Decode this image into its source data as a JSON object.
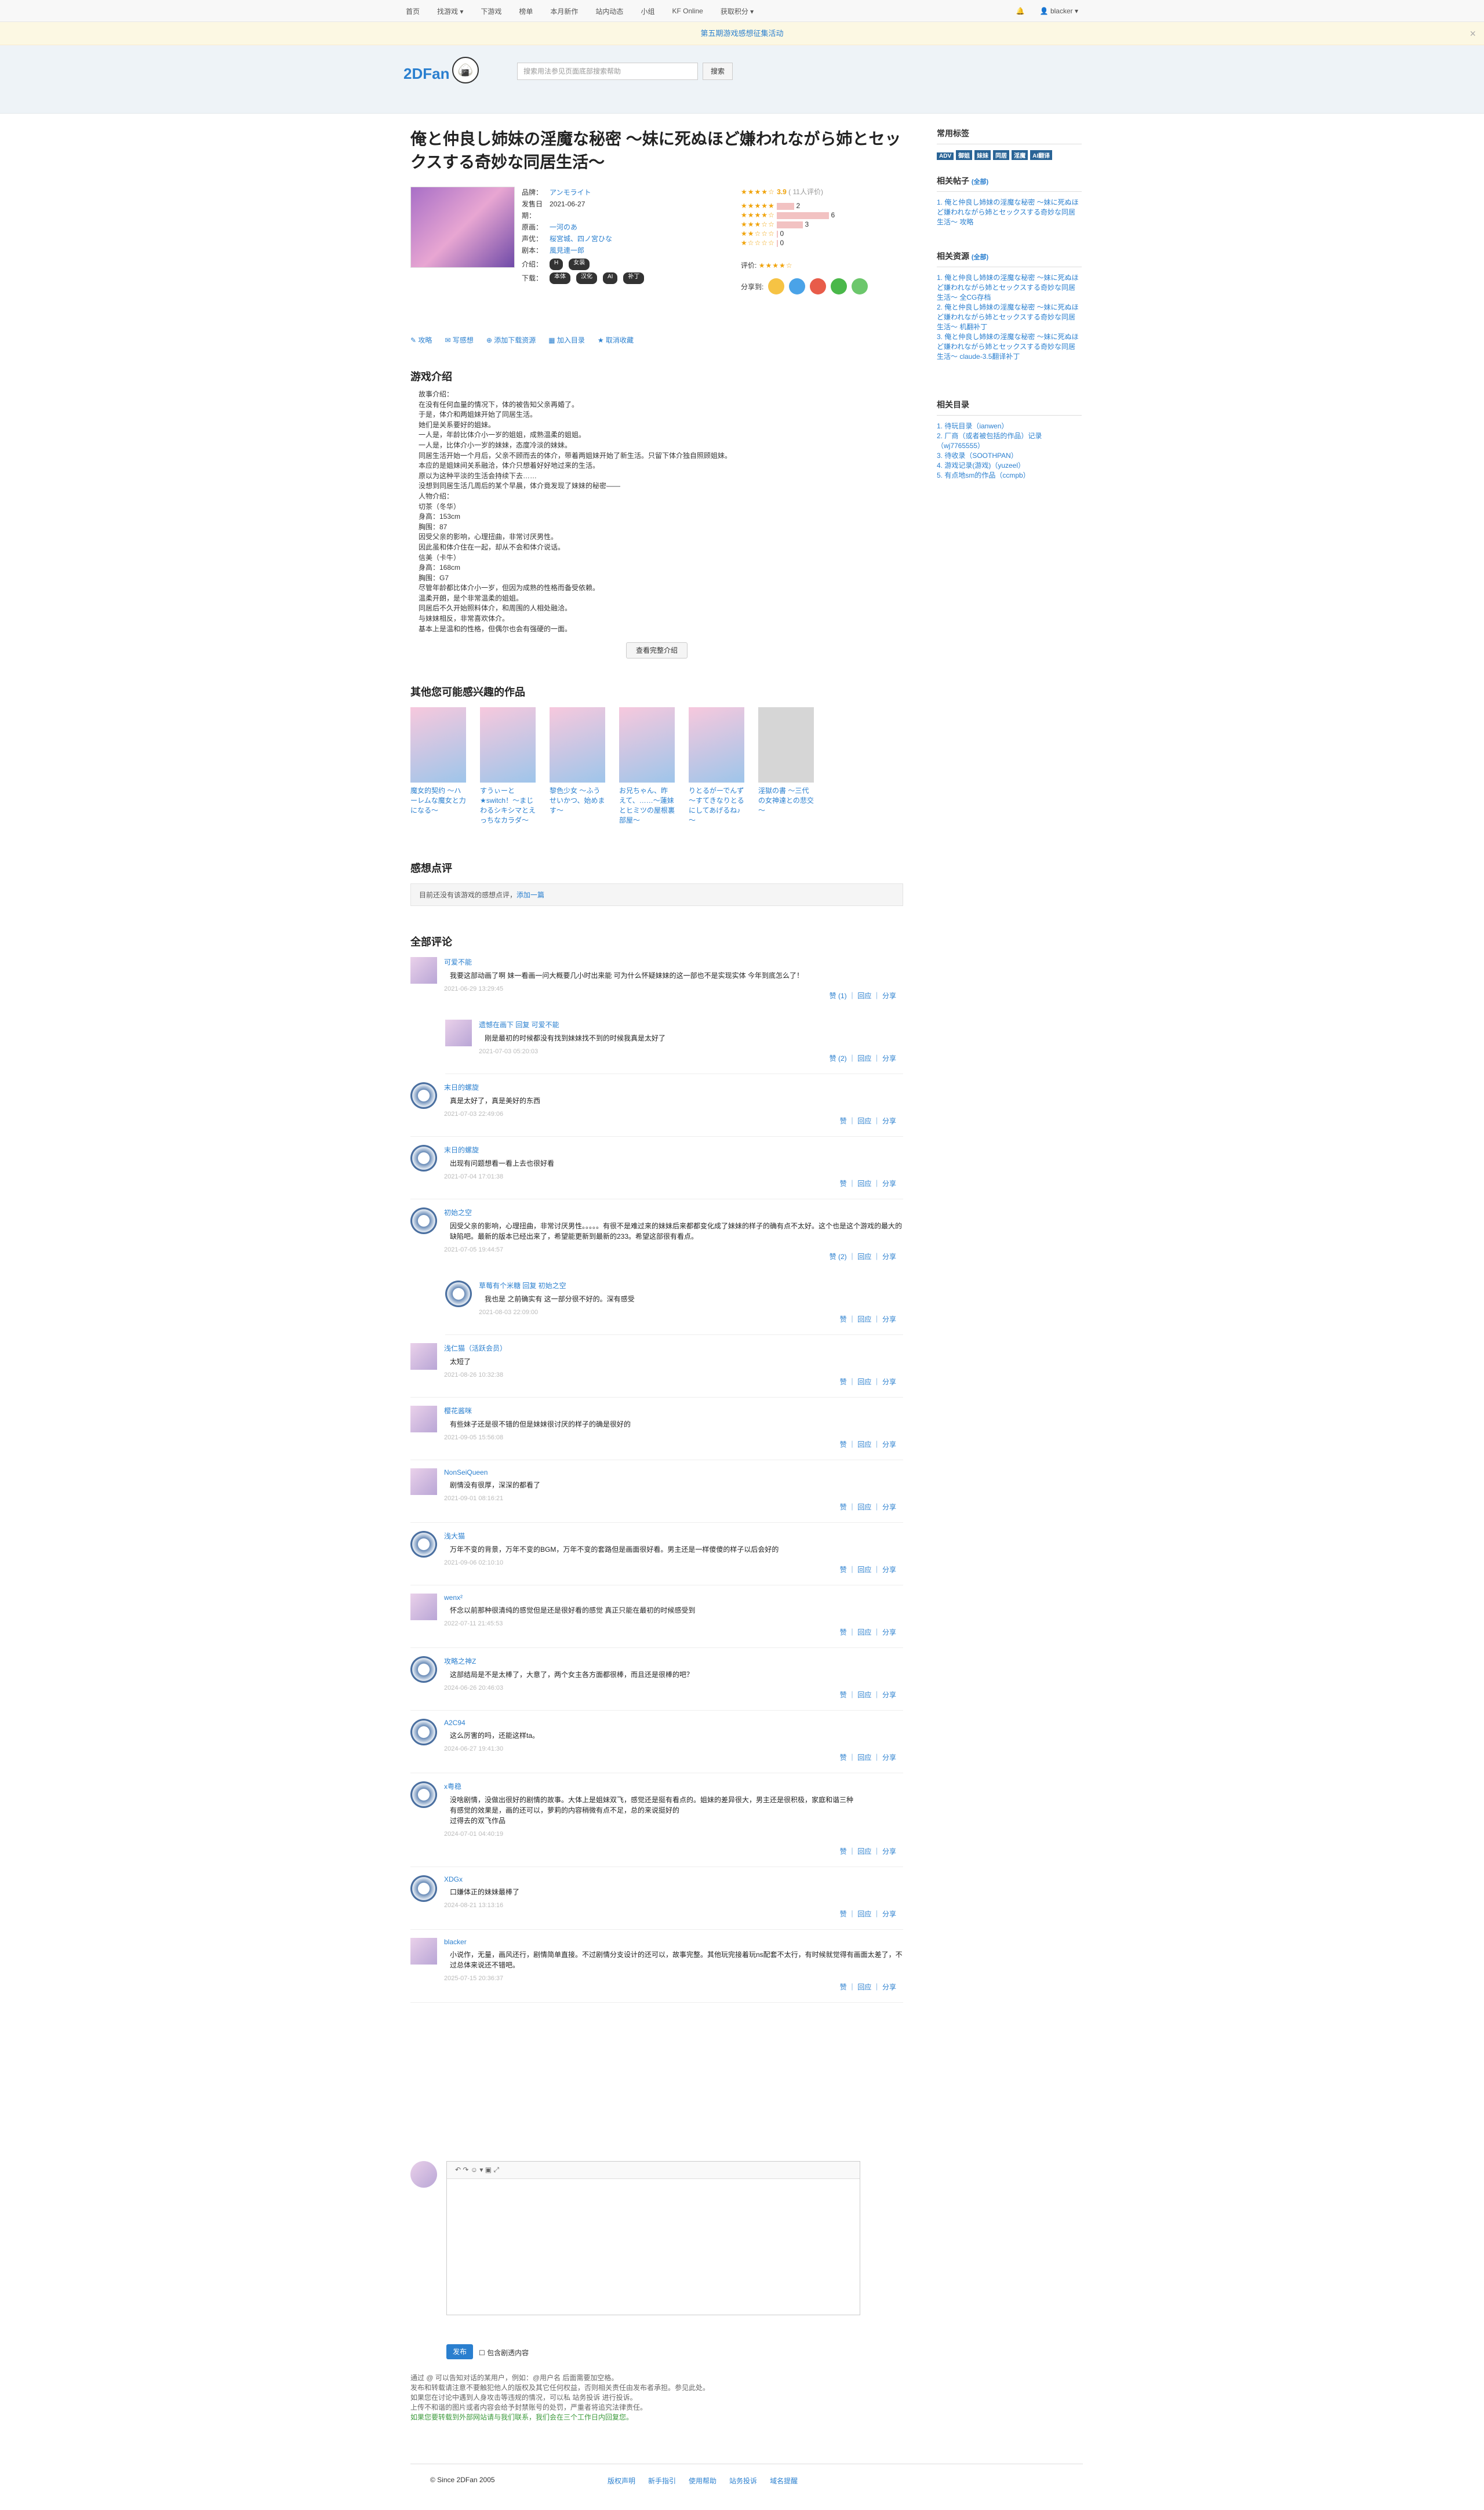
{
  "nav": {
    "items": [
      "首页",
      "找游戏 ▾",
      "下游戏",
      "榜单",
      "本月新作",
      "站内动态",
      "小组",
      "KF Online",
      "获取积分 ▾"
    ],
    "user": "blacker ▾"
  },
  "banner": {
    "text": "第五期游戏感想征集活动",
    "close": "×"
  },
  "header": {
    "logo": "2DFan",
    "search_placeholder": "搜索用法参见页面底部搜索帮助",
    "search_button": "搜索"
  },
  "game": {
    "title": "俺と仲良し姉妹の淫魔な秘密 ～妹に死ぬほど嫌われながら姉とセックスする奇妙な同居生活～",
    "brand": "アンモライト",
    "release": "2021-06-27",
    "original": "一河のあ",
    "cv": "桜宮城、四ノ宮ひな",
    "script": "風見連一郎",
    "intro_tags": [
      "H",
      "女装"
    ],
    "download_tags": [
      "本体",
      "汉化",
      "AI",
      "补丁"
    ]
  },
  "rating": {
    "score": "3.9",
    "count": "( 11人评价)",
    "dist": [
      "2",
      "6",
      "3",
      "0",
      "0"
    ],
    "my_label": "评价:",
    "share_label": "分享到:"
  },
  "actions": [
    "攻略",
    "写感想",
    "添加下载资源",
    "加入目录",
    "取消收藏"
  ],
  "intro": {
    "heading": "游戏介绍",
    "text": "故事介绍：\n在没有任何血量的情况下，体的被告知父亲再婚了。\n于是，体介和两姐妹开始了同居生活。\n她们是关系要好的姐妹。\n一人是，年龄比体介小一岁的姐姐，成熟温柔的姐姐。\n一人是，比体介小一岁的妹妹，态度冷淡的妹妹。\n同居生活开始一个月后，父亲不顾而去的体介，带着两姐妹开始了新生活。只留下体介独自照顾姐妹。\n本应的是姐妹间关系融洽，体介只想着好好地过来的生活。\n原以为这种平淡的生活会持续下去……\n没想到同居生活几周后的某个早晨，体介竟发现了妹妹的秘密——\n人物介绍：\n切茶（冬华）\n身高：153cm\n胸围：87\n因受父亲的影响，心理扭曲，非常讨厌男性。\n因此虽和体介住在一起，却从不会和体介说话。\n信美（卡牛）\n身高：168cm\n胸围：G7\n尽管年龄都比体介小一岁，但因为成熟的性格而备受依赖。\n温柔开朗，是个非常温柔的姐姐。\n同居后不久开始照料体介，和周围的人相处融洽。\n与妹妹相反，非常喜欢体介。\n基本上是温和的性格，但偶尔也会有强硬的一面。",
    "more_button": "查看完整介绍"
  },
  "recommend": {
    "heading": "其他您可能感兴趣的作品",
    "items": [
      "魔女的契约 ～ハーレムな魔女と力になる～",
      "すうぃーと★switch！～まじわるシキシマとえっちなカラダ～",
      "黎色少女 ～ふうせいかつ、始めます～",
      "お兄ちゃん、昨えて、……～蓮妹とヒミツの屋根裏部屋～",
      "りとるがーでんず ～すてきなりとるにしてあげるね♪～",
      "淫獄の書 ～三代の女神達との悲交～"
    ]
  },
  "review": {
    "heading": "感想点评",
    "empty": "目前还没有该游戏的感想点评，",
    "link": "添加一篇"
  },
  "comments_heading": "全部评论",
  "comments": [
    {
      "name": "可爱不能",
      "text": "我要这部动画了啊 妹一看画一问大概要几小时出来能 可为什么怀疑妹妹的这一部也不是实现实体 今年到底怎么了！",
      "time": "2021-06-29 13:29:45",
      "act": "赞 (1) ｜ 回应 ｜ 分享"
    },
    {
      "name": "遗憾在画下 回复 可爱不能",
      "text": "刚是最初的时候都没有找到妹妹找不到的时候我真是太好了",
      "time": "2021-07-03 05:20:03",
      "act": "赞 (2) ｜ 回应 ｜ 分享"
    },
    {
      "name": "末日的螺旋",
      "text": "真是太好了，真是美好的东西",
      "time": "2021-07-03 22:49:06",
      "act": "赞 ｜ 回应 ｜ 分享"
    },
    {
      "name": "末日的螺旋",
      "text": "出现有问题想看一看上去也很好看",
      "time": "2021-07-04 17:01:38",
      "act": "赞 ｜ 回应 ｜ 分享"
    },
    {
      "name": "初始之空",
      "text": "因受父亲的影响，心理扭曲，非常讨厌男性。。。。。有很不是难过来的妹妹后来都都变化成了妹妹的样子的确有点不太好。这个也是这个游戏的最大的缺陷吧。最新的版本已经出来了，希望能更新到最新的233。希望这部很有看点。",
      "time": "2021-07-05 19:44:57",
      "act": "赞 (2) ｜ 回应 ｜ 分享"
    },
    {
      "name": "草莓有个米糖 回复 初始之空",
      "text": "我也是 之前确实有 这一部分很不好的。深有感受",
      "time": "2021-08-03 22:09:00",
      "act": "赞 ｜ 回应 ｜ 分享"
    },
    {
      "name": "浅仁猫（活跃会员）",
      "text": "太短了",
      "time": "2021-08-26 10:32:38",
      "act": "赞 ｜ 回应 ｜ 分享"
    },
    {
      "name": "樱花酱咪",
      "text": "有些妹子还是很不错的但是妹妹很讨厌的样子的确是很好的",
      "time": "2021-09-05 15:56:08",
      "act": "赞 ｜ 回应 ｜ 分享"
    },
    {
      "name": "NonSeiQueen",
      "text": "剧情没有很厚，深深的都看了",
      "time": "2021-09-01 08:16:21",
      "act": "赞 ｜ 回应 ｜ 分享"
    },
    {
      "name": "浅大猫",
      "text": "万年不变的背景，万年不变的BGM，万年不变的套路但是画面很好看。男主还是一样傻傻的样子以后会好的",
      "time": "2021-09-06 02:10:10",
      "act": "赞 ｜ 回应 ｜ 分享"
    },
    {
      "name": "wenx²",
      "text": "怀念以前那种很清纯的感觉但是还是很好看的感觉 真正只能在最初的时候感受到",
      "time": "2022-07-11 21:45:53",
      "act": "赞 ｜ 回应 ｜ 分享"
    },
    {
      "name": "攻略之神Z",
      "text": "这部结局是不是太棒了，大意了，两个女主各方面都很棒，而且还是很棒的吧？",
      "time": "2024-06-26 20:46:03",
      "act": "赞 ｜ 回应 ｜ 分享"
    },
    {
      "name": "A2C94",
      "text": "这么厉害的吗，还能这样ta。",
      "time": "2024-06-27 19:41:30",
      "act": "赞 ｜ 回应 ｜ 分享"
    },
    {
      "name": "x粤稳",
      "text": "没啥剧情，没做出很好的剧情的故事。大体上是姐妹双飞，感觉还是挺有看点的。姐妹的差异很大，男主还是很积极，家庭和谐三种\n有感觉的效果是，画的还可以，萝莉的内容稍微有点不足，总的来说挺好的\n过得去的双飞作品",
      "time": "2024-07-01 04:40:19",
      "act": "赞 ｜ 回应 ｜ 分享"
    },
    {
      "name": "XDGx",
      "text": "口嫌体正的妹妹最棒了",
      "time": "2024-08-21 13:13:16",
      "act": "赞 ｜ 回应 ｜ 分享"
    },
    {
      "name": "blacker",
      "text": "小说作，无量，画风还行，剧情简单直接。不过剧情分支设计的还可以，故事完整。其他玩完接着玩ns配套不太行，有时候就觉得有画面太差了，不过总体来说还不错吧。",
      "time": "2025-07-15 20:36:37",
      "act": "赞 ｜ 回应 ｜ 分享"
    }
  ],
  "editor": {
    "toolbar": "↶ ↷ ☺ ▾ ▣ ⤢",
    "submit": "发布",
    "checkbox_label": "包含剧透内容"
  },
  "footer_note": [
    "通过 @ 可以告知对话的某用户，例如：@用户名 后面需要加空格。",
    "发布和转载请注意不要触犯他人的版权及其它任何权益，否则相关责任由发布者承担。参见此处。",
    "如果您在讨论中遇到人身攻击等违规的情况，可以私 站务投诉 进行投诉。",
    "上传不和谐的图片或者内容会给予封禁账号的处罚，严重者将追究法律责任。",
    "如果您要转载到外部网站请与我们联系，我们会在三个工作日内回复您。"
  ],
  "footer": {
    "copy": "© Since 2DFan 2005",
    "links": [
      "版权声明",
      "新手指引",
      "使用帮助",
      "站务投诉",
      "域名提醒"
    ]
  },
  "sidebar": {
    "tags_heading": "常用标签",
    "tags": [
      "ADV",
      "御姐",
      "妹妹",
      "同居",
      "淫魔",
      "AI翻译"
    ],
    "posts_heading": "相关帖子",
    "posts_count": "(全部)",
    "posts": [
      "1. 俺と仲良し姉妹の淫魔な秘密 ～妹に死ぬほど嫌われながら姉とセックスする奇妙な同居生活～ 攻略"
    ],
    "res_heading": "相关资源",
    "res_count": "(全部)",
    "res": [
      "1. 俺と仲良し姉妹の淫魔な秘密 ～妹に死ぬほど嫌われながら姉とセックスする奇妙な同居生活～ 全CG存档",
      "2. 俺と仲良し姉妹の淫魔な秘密 ～妹に死ぬほど嫌われながら姉とセックスする奇妙な同居生活～ 机翻补丁",
      "3. 俺と仲良し姉妹の淫魔な秘密 ～妹に死ぬほど嫌われながら姉とセックスする奇妙な同居生活～ claude-3.5翻译补丁"
    ],
    "dir_heading": "相关目录",
    "dirs": [
      "1. 待玩目录（ianwen）",
      "2. 厂商（或者被包括的作品）记录（wj7765555）",
      "3. 待收录（SOOTHPAN）",
      "4. 游戏记录(游戏)（yuzeel）",
      "5. 有点地sm的作品（ccmpb）"
    ]
  }
}
